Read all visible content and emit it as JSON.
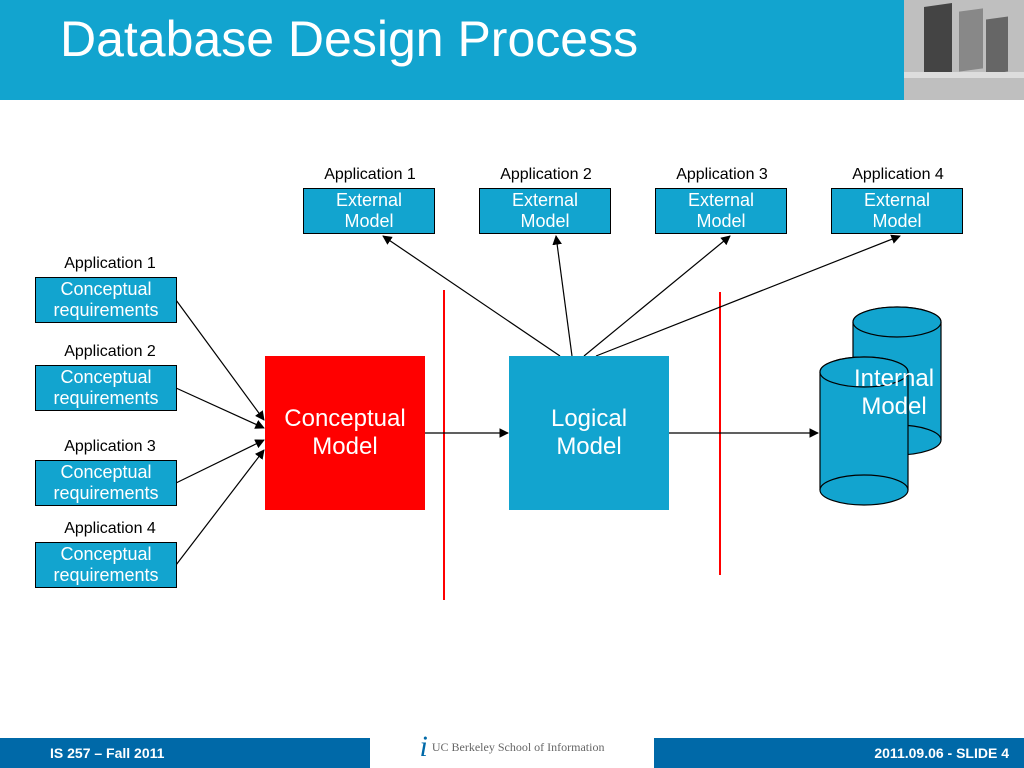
{
  "title": "Database Design Process",
  "footer": {
    "left": "IS 257 – Fall 2011",
    "center": "UC Berkeley School of Information",
    "right": "2011.09.06 - SLIDE 4"
  },
  "requirements": [
    {
      "app": "Application 1",
      "label": "Conceptual\nrequirements"
    },
    {
      "app": "Application 2",
      "label": "Conceptual\nrequirements"
    },
    {
      "app": "Application 3",
      "label": "Conceptual\nrequirements"
    },
    {
      "app": "Application 4",
      "label": "Conceptual\nrequirements"
    }
  ],
  "externals": [
    {
      "app": "Application 1",
      "label": "External\nModel"
    },
    {
      "app": "Application 2",
      "label": "External\nModel"
    },
    {
      "app": "Application 3",
      "label": "External\nModel"
    },
    {
      "app": "Application 4",
      "label": "External\nModel"
    }
  ],
  "conceptual": "Conceptual\nModel",
  "logical": "Logical\nModel",
  "internal": "Internal\nModel",
  "colors": {
    "titlebar": "#12a4cf",
    "footer": "#0069a8",
    "boxblue": "#12a4cf",
    "boxred": "#ff0000",
    "sep": "#ff0000"
  }
}
